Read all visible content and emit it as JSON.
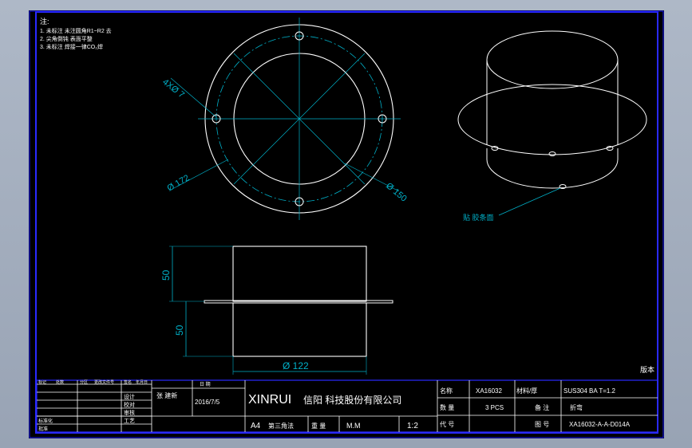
{
  "notes": {
    "heading": "注:",
    "lines": [
      "1. 未标注 未注圆角R1~R2 去",
      "2. 尖角倒钝 表面平整",
      "3. 未标注 焊接一律CO₂焊"
    ]
  },
  "top_view": {
    "hole_callout": "4XØ 7",
    "outer_dia": "Ø 172",
    "inner_dia": "Ø 150"
  },
  "iso_view": {
    "callout": "贴 胶条面"
  },
  "side_view": {
    "dim_top": "50",
    "dim_bottom": "50",
    "dim_width": "Ø 122"
  },
  "corner_mark": "版本",
  "title_block": {
    "rev_headers": [
      "标记",
      "处数",
      "分区",
      "更改文件号",
      "签名",
      "年月日"
    ],
    "role_labels": [
      "设计",
      "校对",
      "审核",
      "工艺",
      "标准化",
      "批准"
    ],
    "designer": "张 建新",
    "date_label": "日 期",
    "date": "2016/7/5",
    "company_en": "XINRUI",
    "company_cn": "信阳 科技股份有限公司",
    "sheet_size": "A4",
    "sheet_note": "第三角法",
    "weight_label": "重 量",
    "weight": "M.M",
    "scale": "1:2",
    "name_label": "名称",
    "name": "XA16032",
    "material_label": "材料/厚",
    "material": "SUS304  BA  T=1.2",
    "qty_label": "数 量",
    "qty": "3   PCS",
    "process_label": "备 注",
    "process": "折弯",
    "code_label": "代 号",
    "code": "XA16032-A-A-D014A",
    "drawing_label": "图 号"
  }
}
